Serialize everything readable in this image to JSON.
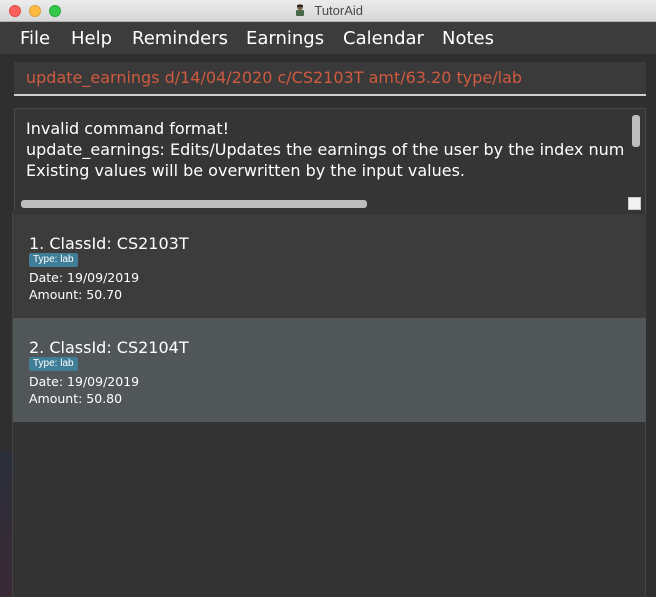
{
  "window": {
    "title": "TutorAid"
  },
  "menu": [
    "File",
    "Help",
    "Reminders",
    "Earnings",
    "Calendar",
    "Notes"
  ],
  "command": {
    "value": "update_earnings d/14/04/2020 c/CS2103T amt/63.20 type/lab"
  },
  "result": {
    "lines": [
      "Invalid command format!",
      "update_earnings: Edits/Updates the earnings of the user by the index num",
      "Existing values will be overwritten by the input values."
    ]
  },
  "earnings": [
    {
      "title": "1.  ClassId: CS2103T",
      "tag": "Type: lab",
      "date": "Date: 19/09/2019",
      "amount": "Amount: 50.70"
    },
    {
      "title": "2.  ClassId: CS2104T",
      "tag": "Type: lab",
      "date": "Date: 19/09/2019",
      "amount": "Amount: 50.80"
    }
  ],
  "colors": {
    "command_text": "#d05a3f",
    "tag_bg": "#3f7e96",
    "selected_card": "#515658"
  },
  "icons": [
    "close-window-icon",
    "minimize-window-icon",
    "maximize-window-icon",
    "app-icon"
  ]
}
